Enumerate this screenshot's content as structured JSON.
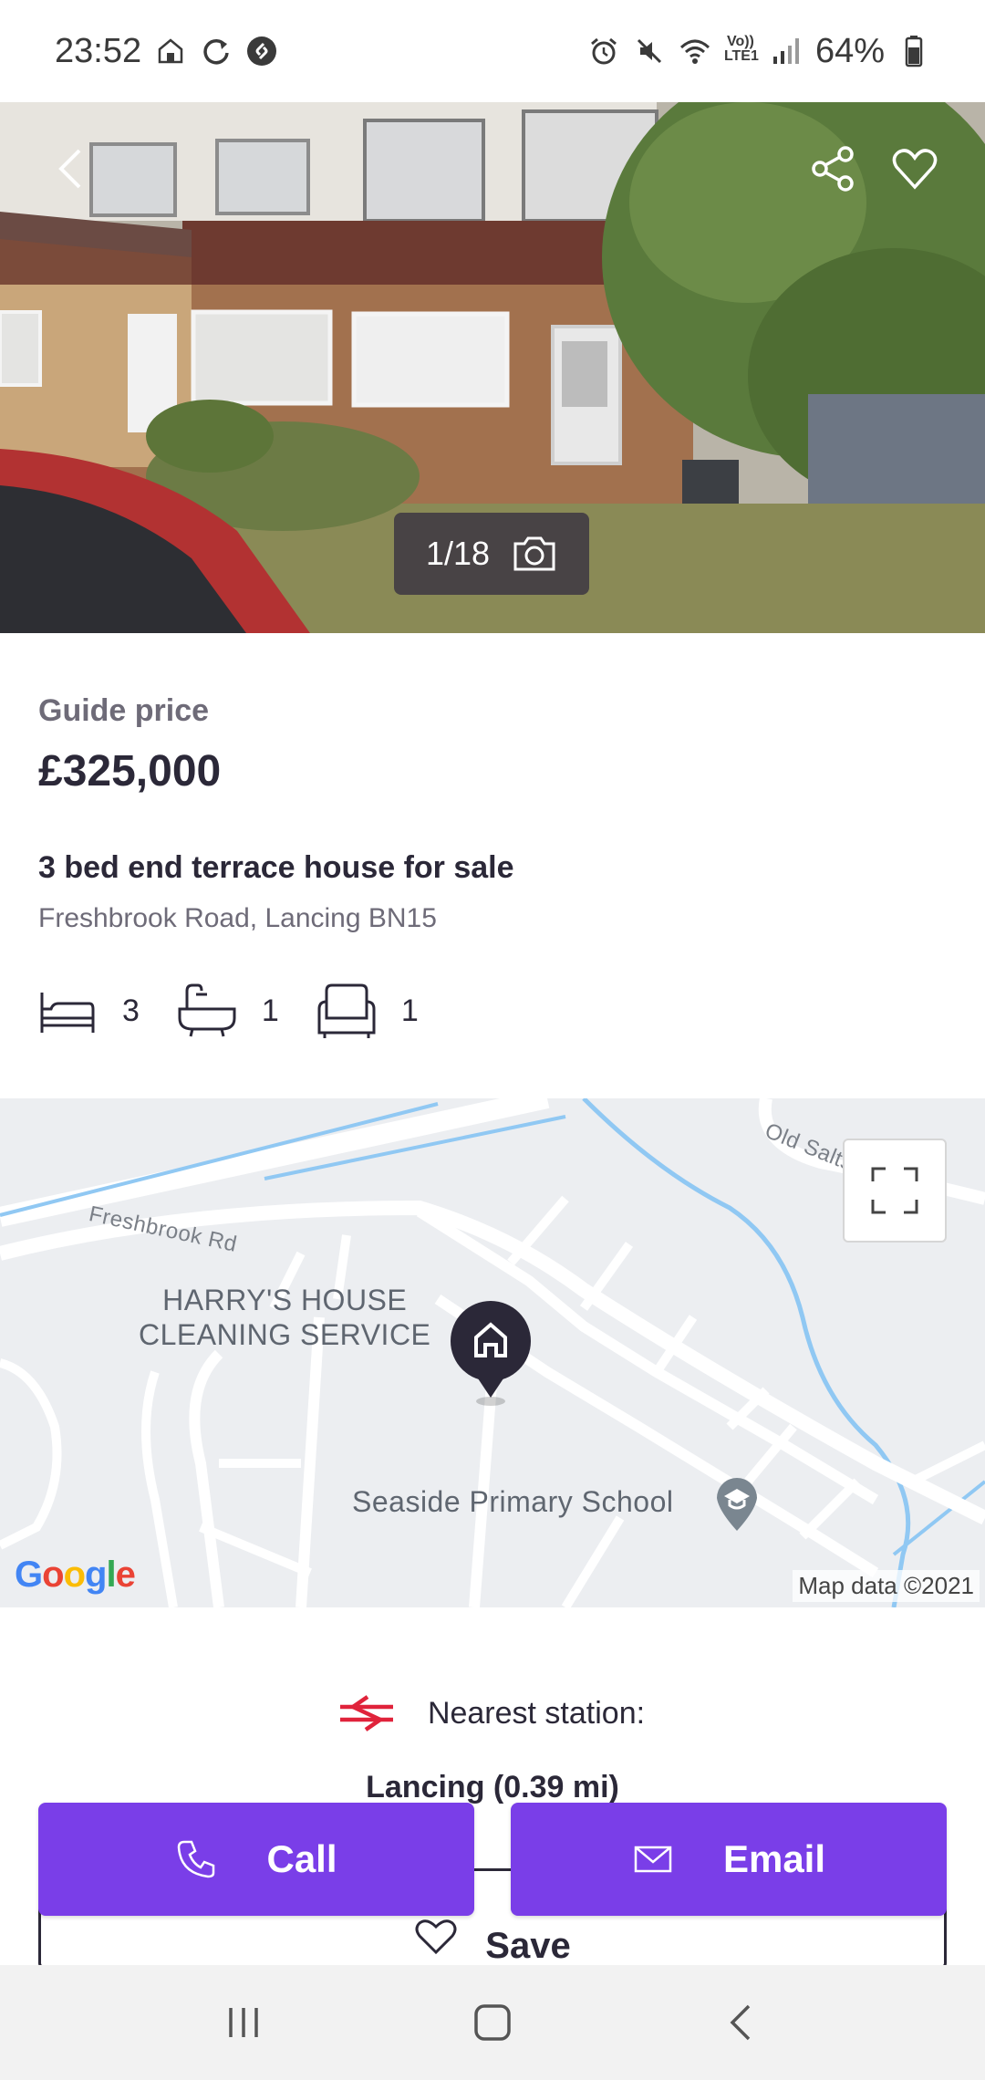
{
  "status_bar": {
    "time": "23:52",
    "battery": "64%",
    "network": "LTE1",
    "left_icons": [
      "house-icon",
      "sync-icon",
      "shazam-icon"
    ],
    "right_icons": [
      "alarm-icon",
      "mute-icon",
      "wifi-icon",
      "volte-icon",
      "signal-icon",
      "battery-icon"
    ]
  },
  "hero": {
    "photo_counter": "1/18",
    "icons": {
      "back": "chevron-left-icon",
      "share": "share-icon",
      "favourite": "heart-icon",
      "camera": "camera-icon"
    }
  },
  "listing": {
    "guide_label": "Guide price",
    "price": "£325,000",
    "title": "3 bed end terrace house for sale",
    "address": "Freshbrook Road, Lancing BN15",
    "features": [
      {
        "icon": "bed-icon",
        "value": "3"
      },
      {
        "icon": "bath-icon",
        "value": "1"
      },
      {
        "icon": "armchair-icon",
        "value": "1"
      }
    ]
  },
  "map": {
    "road_label": "Freshbrook Rd",
    "road_label_2": "Old Salts",
    "poi_1_line1": "HARRY'S HOUSE",
    "poi_1_line2": "CLEANING SERVICE",
    "poi_2": "Seaside Primary School",
    "attribution": "Map data ©2021",
    "logo": "Google"
  },
  "station": {
    "label": "Nearest station:",
    "name": "Lancing (0.39 mi)",
    "icon": "national-rail-icon"
  },
  "actions": {
    "call": "Call",
    "email": "Email",
    "save": "Save"
  },
  "colors": {
    "accent": "#7a3ee8",
    "text_dark": "#2b2838",
    "text_muted": "#6e6b78",
    "rail_red": "#e0233b"
  }
}
